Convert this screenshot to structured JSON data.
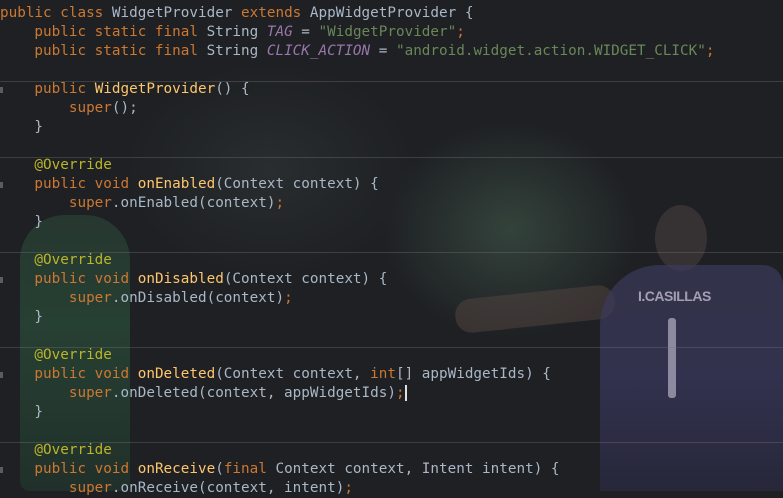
{
  "editor": {
    "lines": [
      [
        {
          "t": "public class ",
          "c": "kw"
        },
        {
          "t": "WidgetProvider ",
          "c": "plain"
        },
        {
          "t": "extends ",
          "c": "kw"
        },
        {
          "t": "AppWidgetProvider {",
          "c": "plain"
        }
      ],
      [
        {
          "t": "    public static final ",
          "c": "kw"
        },
        {
          "t": "String ",
          "c": "plain"
        },
        {
          "t": "TAG",
          "c": "const"
        },
        {
          "t": " = ",
          "c": "plain"
        },
        {
          "t": "\"WidgetProvider\"",
          "c": "str"
        },
        {
          "t": ";",
          "c": "kw"
        }
      ],
      [
        {
          "t": "    public static final ",
          "c": "kw"
        },
        {
          "t": "String ",
          "c": "plain"
        },
        {
          "t": "CLICK_ACTION",
          "c": "const"
        },
        {
          "t": " = ",
          "c": "plain"
        },
        {
          "t": "\"android.widget.action.WIDGET_CLICK\"",
          "c": "str"
        },
        {
          "t": ";",
          "c": "kw"
        }
      ],
      [],
      [
        {
          "t": "    public ",
          "c": "kw"
        },
        {
          "t": "WidgetProvider",
          "c": "fn"
        },
        {
          "t": "() {",
          "c": "plain"
        }
      ],
      [
        {
          "t": "        super",
          "c": "kw"
        },
        {
          "t": "();",
          "c": "plain"
        }
      ],
      [
        {
          "t": "    }",
          "c": "plain"
        }
      ],
      [],
      [
        {
          "t": "    @Override",
          "c": "ann"
        }
      ],
      [
        {
          "t": "    public void ",
          "c": "kw"
        },
        {
          "t": "onEnabled",
          "c": "fn"
        },
        {
          "t": "(Context context) {",
          "c": "plain"
        }
      ],
      [
        {
          "t": "        super",
          "c": "kw"
        },
        {
          "t": ".onEnabled(context)",
          "c": "plain"
        },
        {
          "t": ";",
          "c": "kw"
        }
      ],
      [
        {
          "t": "    }",
          "c": "plain"
        }
      ],
      [],
      [
        {
          "t": "    @Override",
          "c": "ann"
        }
      ],
      [
        {
          "t": "    public void ",
          "c": "kw"
        },
        {
          "t": "onDisabled",
          "c": "fn"
        },
        {
          "t": "(Context context) {",
          "c": "plain"
        }
      ],
      [
        {
          "t": "        super",
          "c": "kw"
        },
        {
          "t": ".onDisabled(context)",
          "c": "plain"
        },
        {
          "t": ";",
          "c": "kw"
        }
      ],
      [
        {
          "t": "    }",
          "c": "plain"
        }
      ],
      [],
      [
        {
          "t": "    @Override",
          "c": "ann"
        }
      ],
      [
        {
          "t": "    public void ",
          "c": "kw"
        },
        {
          "t": "onDeleted",
          "c": "fn"
        },
        {
          "t": "(Context context, ",
          "c": "plain"
        },
        {
          "t": "int",
          "c": "kw"
        },
        {
          "t": "[] appWidgetIds) {",
          "c": "plain"
        }
      ],
      [
        {
          "t": "        super",
          "c": "kw"
        },
        {
          "t": ".onDeleted(context, appWidgetIds)",
          "c": "plain"
        },
        {
          "t": ";",
          "c": "kw",
          "caret": true
        }
      ],
      [
        {
          "t": "    }",
          "c": "plain"
        }
      ],
      [],
      [
        {
          "t": "    @Override",
          "c": "ann"
        }
      ],
      [
        {
          "t": "    public void ",
          "c": "kw"
        },
        {
          "t": "onReceive",
          "c": "fn"
        },
        {
          "t": "(",
          "c": "plain"
        },
        {
          "t": "final ",
          "c": "kw"
        },
        {
          "t": "Context context, Intent intent) {",
          "c": "plain"
        }
      ],
      [
        {
          "t": "        super",
          "c": "kw"
        },
        {
          "t": ".onReceive(context, intent)",
          "c": "plain"
        },
        {
          "t": ";",
          "c": "kw"
        }
      ]
    ]
  },
  "background": {
    "jersey_name": "I.CASILLAS"
  },
  "colors": {
    "keyword": "#cc7832",
    "function": "#ffc66d",
    "string": "#6a8759",
    "constant": "#9876aa",
    "annotation": "#bbb529",
    "text": "#a9b7c6"
  }
}
